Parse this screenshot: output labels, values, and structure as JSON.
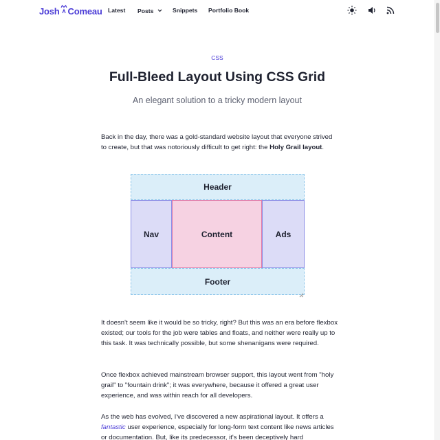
{
  "header": {
    "logo_first": "Josh",
    "logo_second": "Comeau",
    "nav": [
      "Latest",
      "Posts",
      "Snippets",
      "Portfolio Book"
    ]
  },
  "article": {
    "category": "CSS",
    "title": "Full-Bleed Layout Using CSS Grid",
    "subtitle": "An elegant solution to a tricky modern layout",
    "p1_text": "Back in the day, there was a gold-standard website layout that everyone strived to create, but that was notoriously difficult to get right: the ",
    "p1_bold": "Holy Grail layout",
    "p1_end": ".",
    "p2": "It doesn't seem like it would be so tricky, right? But this was an era before flexbox existed; our tools for the job were tables and floats, and neither were really up to this task. It was technically possible, but some shenanigans were required.",
    "p3": "Once flexbox achieved mainstream browser support, this layout went from \"holy grail\" to \"fountain drink\"; it was everywhere, because it offered a great user experience, and was within reach for all developers.",
    "p4_start": "As the web has evolved, I've discovered a new aspirational layout. It offers a ",
    "p4_em": "fantastic",
    "p4_end": " user experience, especially for long-form text content like news articles or documentation. But, like its predecessor, it's been deceptively hard"
  },
  "diagram": {
    "header": "Header",
    "nav": "Nav",
    "content": "Content",
    "ads": "Ads",
    "footer": "Footer"
  },
  "colors": {
    "accent": "#4a3bd6",
    "text": "#1f2230",
    "muted": "#5c6070"
  },
  "icons": [
    "sun-icon",
    "volume-icon",
    "rss-icon",
    "chevron-down-icon",
    "resize-handle-icon"
  ]
}
